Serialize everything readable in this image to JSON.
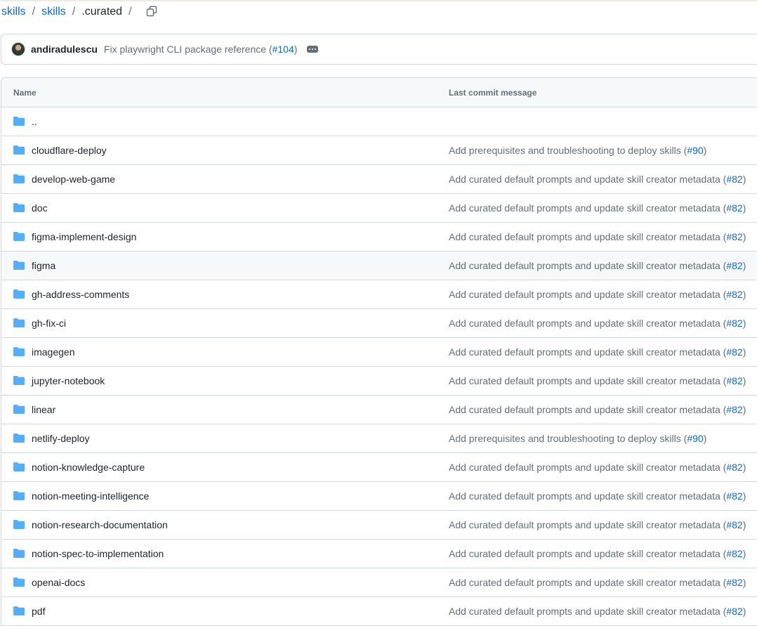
{
  "breadcrumb": {
    "repo": "skills",
    "folder": "skills",
    "current": ".curated",
    "sep": "/",
    "copy_icon": "copy-icon"
  },
  "commit": {
    "author": "andiradulescu",
    "message": "Fix playwright CLI package reference (",
    "pr": "#104",
    "close": ")"
  },
  "table": {
    "headers": {
      "name": "Name",
      "message": "Last commit message"
    },
    "rows": [
      {
        "name": "..",
        "message": "",
        "pr": ""
      },
      {
        "name": "cloudflare-deploy",
        "message": "Add prerequisites and troubleshooting to deploy skills (",
        "pr": "#90",
        "close": ")"
      },
      {
        "name": "develop-web-game",
        "message": "Add curated default prompts and update skill creator metadata (",
        "pr": "#82",
        "close": ")"
      },
      {
        "name": "doc",
        "message": "Add curated default prompts and update skill creator metadata (",
        "pr": "#82",
        "close": ")"
      },
      {
        "name": "figma-implement-design",
        "message": "Add curated default prompts and update skill creator metadata (",
        "pr": "#82",
        "close": ")"
      },
      {
        "name": "figma",
        "message": "Add curated default prompts and update skill creator metadata (",
        "pr": "#82",
        "close": ")"
      },
      {
        "name": "gh-address-comments",
        "message": "Add curated default prompts and update skill creator metadata (",
        "pr": "#82",
        "close": ")"
      },
      {
        "name": "gh-fix-ci",
        "message": "Add curated default prompts and update skill creator metadata (",
        "pr": "#82",
        "close": ")"
      },
      {
        "name": "imagegen",
        "message": "Add curated default prompts and update skill creator metadata (",
        "pr": "#82",
        "close": ")"
      },
      {
        "name": "jupyter-notebook",
        "message": "Add curated default prompts and update skill creator metadata (",
        "pr": "#82",
        "close": ")"
      },
      {
        "name": "linear",
        "message": "Add curated default prompts and update skill creator metadata (",
        "pr": "#82",
        "close": ")"
      },
      {
        "name": "netlify-deploy",
        "message": "Add prerequisites and troubleshooting to deploy skills (",
        "pr": "#90",
        "close": ")"
      },
      {
        "name": "notion-knowledge-capture",
        "message": "Add curated default prompts and update skill creator metadata (",
        "pr": "#82",
        "close": ")"
      },
      {
        "name": "notion-meeting-intelligence",
        "message": "Add curated default prompts and update skill creator metadata (",
        "pr": "#82",
        "close": ")"
      },
      {
        "name": "notion-research-documentation",
        "message": "Add curated default prompts and update skill creator metadata (",
        "pr": "#82",
        "close": ")"
      },
      {
        "name": "notion-spec-to-implementation",
        "message": "Add curated default prompts and update skill creator metadata (",
        "pr": "#82",
        "close": ")"
      },
      {
        "name": "openai-docs",
        "message": "Add curated default prompts and update skill creator metadata (",
        "pr": "#82",
        "close": ")"
      },
      {
        "name": "pdf",
        "message": "Add curated default prompts and update skill creator metadata (",
        "pr": "#82",
        "close": ")"
      }
    ]
  },
  "colors": {
    "link": "#0969da",
    "folder": "#54aeff",
    "muted": "#656d76",
    "border": "#d0d7de"
  }
}
